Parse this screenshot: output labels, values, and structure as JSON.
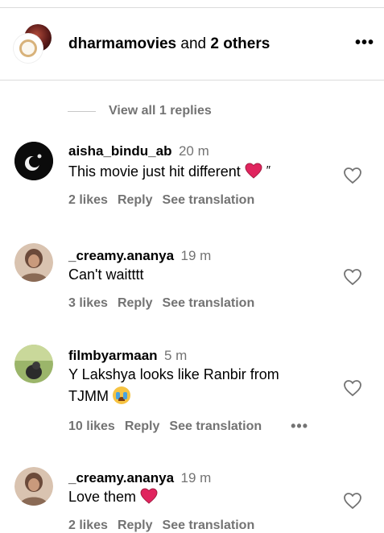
{
  "header": {
    "primary_user": "dharmamovies",
    "connector": "and",
    "others": "2 others",
    "more_label": "•••"
  },
  "view_replies": "View all 1 replies",
  "comments": [
    {
      "username": "aisha_bindu_ab",
      "time": "20 m",
      "text": "This movie just hit different",
      "text_suffix": "″",
      "emoji": "red-heart",
      "likes": "2 likes",
      "reply": "Reply",
      "translate": "See translation",
      "avatar_colors": [
        "#111111",
        "#ffffff"
      ]
    },
    {
      "username": "_creamy.ananya",
      "time": "19 m",
      "text": "Can't waitttt",
      "likes": "3 likes",
      "reply": "Reply",
      "translate": "See translation",
      "avatar_colors": [
        "#c9a88f",
        "#6b4a3a"
      ]
    },
    {
      "username": "filmbyarmaan",
      "time": "5 m",
      "text_line1": "Y Lakshya looks like Ranbir from",
      "text_line2": "TJMM",
      "emoji": "loudly-crying-face",
      "likes": "10 likes",
      "reply": "Reply",
      "translate": "See translation",
      "more_label": "•••",
      "avatar_colors": [
        "#8aa85a",
        "#2b2b2b"
      ]
    },
    {
      "username": "_creamy.ananya",
      "time": "19 m",
      "text": "Love them",
      "emoji": "red-heart",
      "likes": "2 likes",
      "reply": "Reply",
      "translate": "See translation",
      "avatar_colors": [
        "#c9a88f",
        "#6b4a3a"
      ]
    }
  ],
  "colors": {
    "secondary_text": "#737373",
    "divider": "#dbdbdb",
    "heart_red": "#e0245e"
  }
}
